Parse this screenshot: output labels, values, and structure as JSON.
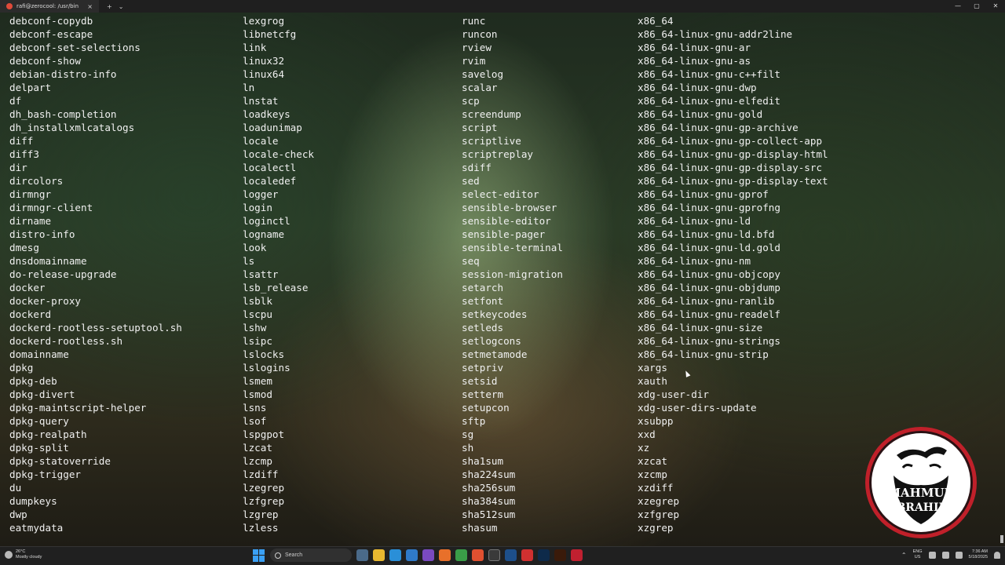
{
  "window": {
    "tab_title": "rafi@zerocool: /usr/bin",
    "tab_close": "×",
    "new_tab": "+",
    "dropdown": "⌄",
    "controls": [
      "—",
      "▢",
      "✕"
    ]
  },
  "listing": {
    "column_1": [
      "debconf-copydb",
      "debconf-escape",
      "debconf-set-selections",
      "debconf-show",
      "debian-distro-info",
      "delpart",
      "df",
      "dh_bash-completion",
      "dh_installxmlcatalogs",
      "diff",
      "diff3",
      "dir",
      "dircolors",
      "dirmngr",
      "dirmngr-client",
      "dirname",
      "distro-info",
      "dmesg",
      "dnsdomainname",
      "do-release-upgrade",
      "docker",
      "docker-proxy",
      "dockerd",
      "dockerd-rootless-setuptool.sh",
      "dockerd-rootless.sh",
      "domainname",
      "dpkg",
      "dpkg-deb",
      "dpkg-divert",
      "dpkg-maintscript-helper",
      "dpkg-query",
      "dpkg-realpath",
      "dpkg-split",
      "dpkg-statoverride",
      "dpkg-trigger",
      "du",
      "dumpkeys",
      "dwp",
      "eatmydata"
    ],
    "column_2": [
      "lexgrog",
      "libnetcfg",
      "link",
      "linux32",
      "linux64",
      "ln",
      "lnstat",
      "loadkeys",
      "loadunimap",
      "locale",
      "locale-check",
      "localectl",
      "localedef",
      "logger",
      "login",
      "loginctl",
      "logname",
      "look",
      "ls",
      "lsattr",
      "lsb_release",
      "lsblk",
      "lscpu",
      "lshw",
      "lsipc",
      "lslocks",
      "lslogins",
      "lsmem",
      "lsmod",
      "lsns",
      "lsof",
      "lspgpot",
      "lzcat",
      "lzcmp",
      "lzdiff",
      "lzegrep",
      "lzfgrep",
      "lzgrep",
      "lzless"
    ],
    "column_3": [
      "runc",
      "runcon",
      "rview",
      "rvim",
      "savelog",
      "scalar",
      "scp",
      "screendump",
      "script",
      "scriptlive",
      "scriptreplay",
      "sdiff",
      "sed",
      "select-editor",
      "sensible-browser",
      "sensible-editor",
      "sensible-pager",
      "sensible-terminal",
      "seq",
      "session-migration",
      "setarch",
      "setfont",
      "setkeycodes",
      "setleds",
      "setlogcons",
      "setmetamode",
      "setpriv",
      "setsid",
      "setterm",
      "setupcon",
      "sftp",
      "sg",
      "sh",
      "sha1sum",
      "sha224sum",
      "sha256sum",
      "sha384sum",
      "sha512sum",
      "shasum"
    ],
    "column_4": [
      "x86_64",
      "x86_64-linux-gnu-addr2line",
      "x86_64-linux-gnu-ar",
      "x86_64-linux-gnu-as",
      "x86_64-linux-gnu-c++filt",
      "x86_64-linux-gnu-dwp",
      "x86_64-linux-gnu-elfedit",
      "x86_64-linux-gnu-gold",
      "x86_64-linux-gnu-gp-archive",
      "x86_64-linux-gnu-gp-collect-app",
      "x86_64-linux-gnu-gp-display-html",
      "x86_64-linux-gnu-gp-display-src",
      "x86_64-linux-gnu-gp-display-text",
      "x86_64-linux-gnu-gprof",
      "x86_64-linux-gnu-gprofng",
      "x86_64-linux-gnu-ld",
      "x86_64-linux-gnu-ld.bfd",
      "x86_64-linux-gnu-ld.gold",
      "x86_64-linux-gnu-nm",
      "x86_64-linux-gnu-objcopy",
      "x86_64-linux-gnu-objdump",
      "x86_64-linux-gnu-ranlib",
      "x86_64-linux-gnu-readelf",
      "x86_64-linux-gnu-size",
      "x86_64-linux-gnu-strings",
      "x86_64-linux-gnu-strip",
      "xargs",
      "xauth",
      "xdg-user-dir",
      "xdg-user-dirs-update",
      "xsubpp",
      "xxd",
      "xz",
      "xzcat",
      "xzcmp",
      "xzdiff",
      "xzegrep",
      "xzfgrep",
      "xzgrep"
    ]
  },
  "colors": {
    "terminal_text": "#f0f0f0",
    "taskbar_bg": "#202020",
    "logo_ring": "#c0202a"
  },
  "logo": {
    "text_line_1": "MAHMUD",
    "text_line_2": "IBRAHIM"
  },
  "taskbar": {
    "weather_temp": "26°C",
    "weather_desc": "Mostly cloudy",
    "search_placeholder": "Search",
    "lang_line_1": "ENG",
    "lang_line_2": "US",
    "time": "7:36 AM",
    "date": "5/18/2025",
    "apps": [
      "start-icon",
      "search",
      "widgets-icon",
      "file-explorer-icon",
      "edge-icon",
      "vscode-icon",
      "visual-studio-icon",
      "firefox-icon",
      "chrome-icon",
      "brave-icon",
      "terminal-icon",
      "powershell-icon",
      "photoshop-icon",
      "illustrator-icon"
    ]
  }
}
